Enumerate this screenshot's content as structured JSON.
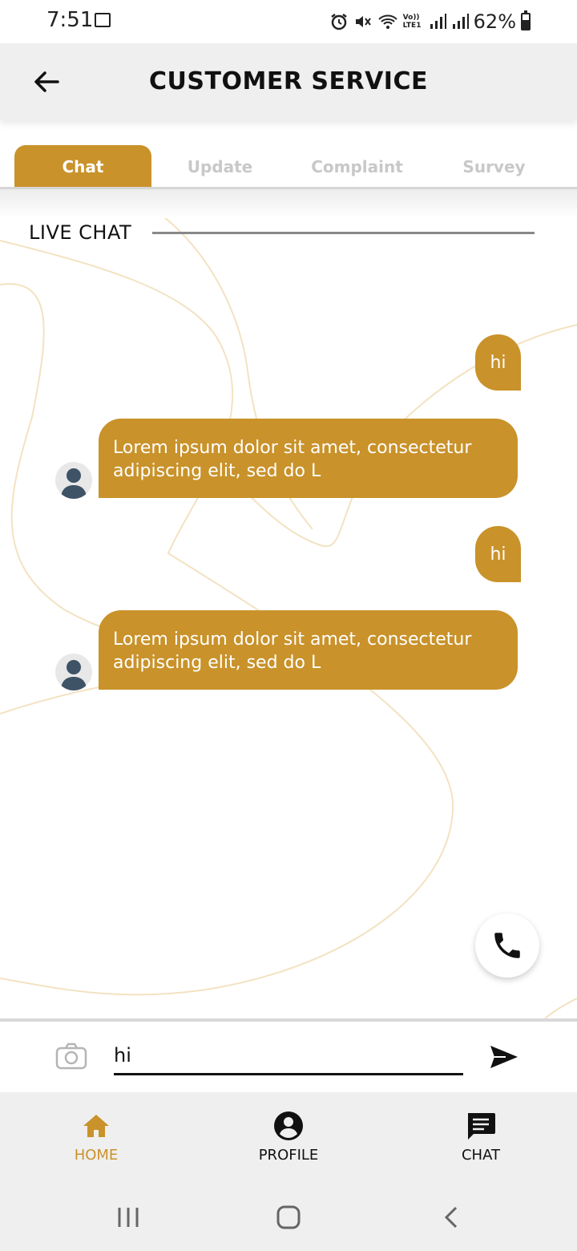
{
  "status_bar": {
    "time": "7:51",
    "battery": "62%",
    "net_label": "Vo)) LTE1"
  },
  "header": {
    "title": "CUSTOMER SERVICE",
    "back_icon": "arrow-left-icon"
  },
  "tabs": [
    {
      "label": "Chat",
      "active": true
    },
    {
      "label": "Update",
      "active": false
    },
    {
      "label": "Complaint",
      "active": false
    },
    {
      "label": "Survey",
      "active": false
    }
  ],
  "section": {
    "label": "LIVE CHAT"
  },
  "messages": [
    {
      "from": "user",
      "text": "hi"
    },
    {
      "from": "agent",
      "text": "Lorem ipsum dolor sit amet, consectetur adipiscing elit, sed do L"
    },
    {
      "from": "user",
      "text": "hi"
    },
    {
      "from": "agent",
      "text": "Lorem ipsum dolor sit amet, consectetur adipiscing elit, sed do L"
    }
  ],
  "composer": {
    "value": "hi",
    "camera_icon": "camera-icon",
    "send_icon": "send-icon"
  },
  "bottom_nav": [
    {
      "label": "HOME",
      "icon": "home-icon",
      "active": true
    },
    {
      "label": "PROFILE",
      "icon": "account-circle-icon",
      "active": false
    },
    {
      "label": "CHAT",
      "icon": "chat-icon",
      "active": false
    }
  ],
  "colors": {
    "accent": "#c9922a",
    "bubble_text": "#ffffff",
    "inactive_tab": "#c8c8c8",
    "bar_bg": "#efefef"
  }
}
